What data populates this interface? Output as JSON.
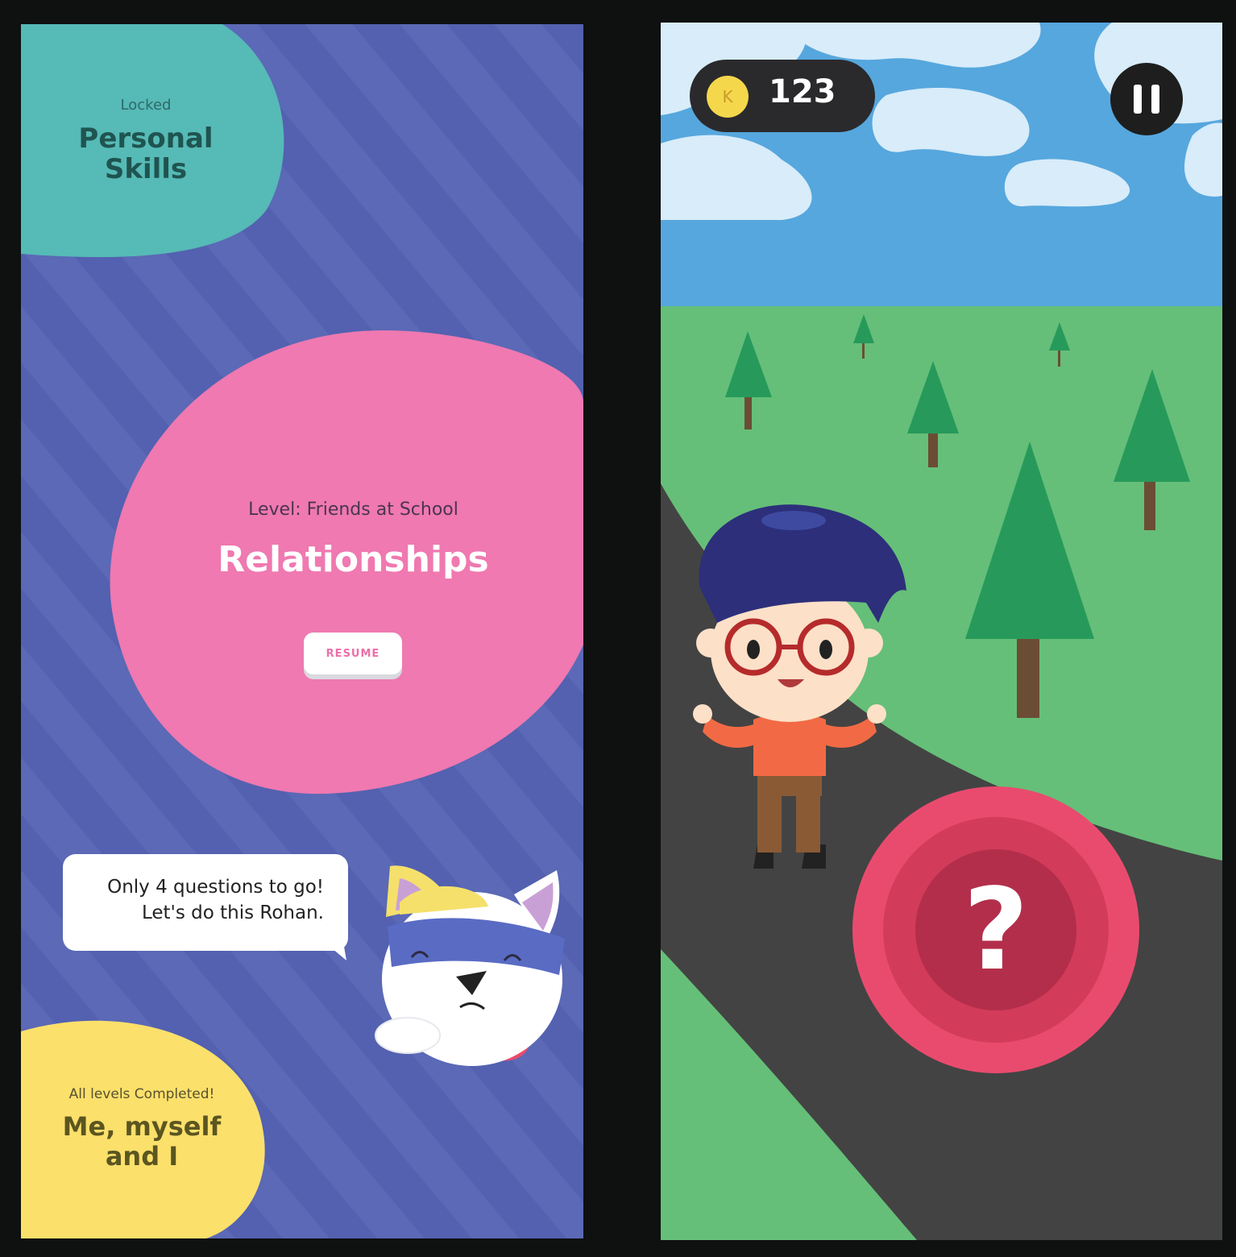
{
  "left_screen": {
    "locked_card": {
      "status": "Locked",
      "title_line1": "Personal",
      "title_line2": "Skills"
    },
    "current_card": {
      "level": "Level: Friends at School",
      "title": "Relationships",
      "resume_label": "RESUME"
    },
    "speech": {
      "line1": "Only  4 questions to go!",
      "line2": "Let's do this Rohan."
    },
    "completed_card": {
      "status": "All levels Completed!",
      "title_line1": "Me, myself",
      "title_line2": "and I"
    }
  },
  "right_screen": {
    "coin_icon": "K",
    "coin_count": "123",
    "pause_icon": "pause-icon",
    "question_icon": "?"
  },
  "colors": {
    "bg_purple": "#5462b0",
    "locked_teal": "#56bab6",
    "current_pink": "#ef79b0",
    "completed_yellow": "#fbe06b",
    "sky": "#56a7de",
    "grass": "#65bf78",
    "road": "#434343",
    "question_red": "#e94b6e"
  }
}
